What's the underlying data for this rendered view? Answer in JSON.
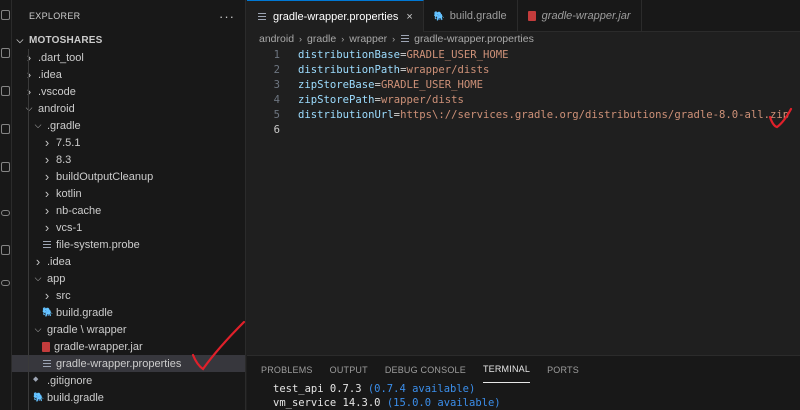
{
  "explorer": {
    "title": "EXPLORER",
    "more": "···",
    "root": "MOTOSHARES",
    "tree": [
      {
        "label": ".dart_tool",
        "depth": 1,
        "kind": "folder-closed"
      },
      {
        "label": ".idea",
        "depth": 1,
        "kind": "folder-closed"
      },
      {
        "label": ".vscode",
        "depth": 1,
        "kind": "folder-closed"
      },
      {
        "label": "android",
        "depth": 1,
        "kind": "folder-open"
      },
      {
        "label": ".gradle",
        "depth": 2,
        "kind": "folder-open"
      },
      {
        "label": "7.5.1",
        "depth": 3,
        "kind": "folder-closed"
      },
      {
        "label": "8.3",
        "depth": 3,
        "kind": "folder-closed"
      },
      {
        "label": "buildOutputCleanup",
        "depth": 3,
        "kind": "folder-closed"
      },
      {
        "label": "kotlin",
        "depth": 3,
        "kind": "folder-closed"
      },
      {
        "label": "nb-cache",
        "depth": 3,
        "kind": "folder-closed"
      },
      {
        "label": "vcs-1",
        "depth": 3,
        "kind": "folder-closed"
      },
      {
        "label": "file-system.probe",
        "depth": 3,
        "kind": "file-lines"
      },
      {
        "label": ".idea",
        "depth": 2,
        "kind": "folder-closed"
      },
      {
        "label": "app",
        "depth": 2,
        "kind": "folder-open"
      },
      {
        "label": "src",
        "depth": 3,
        "kind": "folder-closed"
      },
      {
        "label": "build.gradle",
        "depth": 3,
        "kind": "file-gradle"
      },
      {
        "label": "gradle \\ wrapper",
        "depth": 2,
        "kind": "folder-open"
      },
      {
        "label": "gradle-wrapper.jar",
        "depth": 3,
        "kind": "file-jar"
      },
      {
        "label": "gradle-wrapper.properties",
        "depth": 3,
        "kind": "file-lines",
        "selected": true
      },
      {
        "label": ".gitignore",
        "depth": 2,
        "kind": "file-dot"
      },
      {
        "label": "build.gradle",
        "depth": 2,
        "kind": "file-gradle"
      }
    ]
  },
  "tabs": [
    {
      "label": "gradle-wrapper.properties",
      "icon": "properties-file-icon",
      "active": true,
      "close": "×"
    },
    {
      "label": "build.gradle",
      "icon": "gradle-elephant-icon",
      "active": false
    },
    {
      "label": "gradle-wrapper.jar",
      "icon": "jar-file-icon",
      "active": false,
      "italic": true
    }
  ],
  "breadcrumb": [
    "android",
    "gradle",
    "wrapper",
    "gradle-wrapper.properties"
  ],
  "code": [
    {
      "n": "1",
      "key": "distributionBase",
      "eq": "=",
      "val": "GRADLE_USER_HOME"
    },
    {
      "n": "2",
      "key": "distributionPath",
      "eq": "=",
      "val": "wrapper/dists"
    },
    {
      "n": "3",
      "key": "zipStoreBase",
      "eq": "=",
      "val": "GRADLE_USER_HOME"
    },
    {
      "n": "4",
      "key": "zipStorePath",
      "eq": "=",
      "val": "wrapper/dists"
    },
    {
      "n": "5",
      "key": "distributionUrl",
      "eq": "=",
      "val": "https\\://services.gradle.org/distributions/gradle-8.0-all.zip"
    },
    {
      "n": "6",
      "key": "",
      "eq": "",
      "val": ""
    }
  ],
  "panel": {
    "tabs": [
      "PROBLEMS",
      "OUTPUT",
      "DEBUG CONSOLE",
      "TERMINAL",
      "PORTS"
    ],
    "active_tab": "TERMINAL",
    "terminal_lines": [
      {
        "name": "test_api",
        "version": "0.7.3",
        "available": "(0.7.4 available)"
      },
      {
        "name": "vm_service",
        "version": "14.3.0",
        "available": "(15.0.0 available)"
      }
    ]
  },
  "colors": {
    "accent": "#0078d4",
    "annotation": "#e0202a",
    "jar": "#c33c3c",
    "gradle": "#3c8cb4"
  }
}
